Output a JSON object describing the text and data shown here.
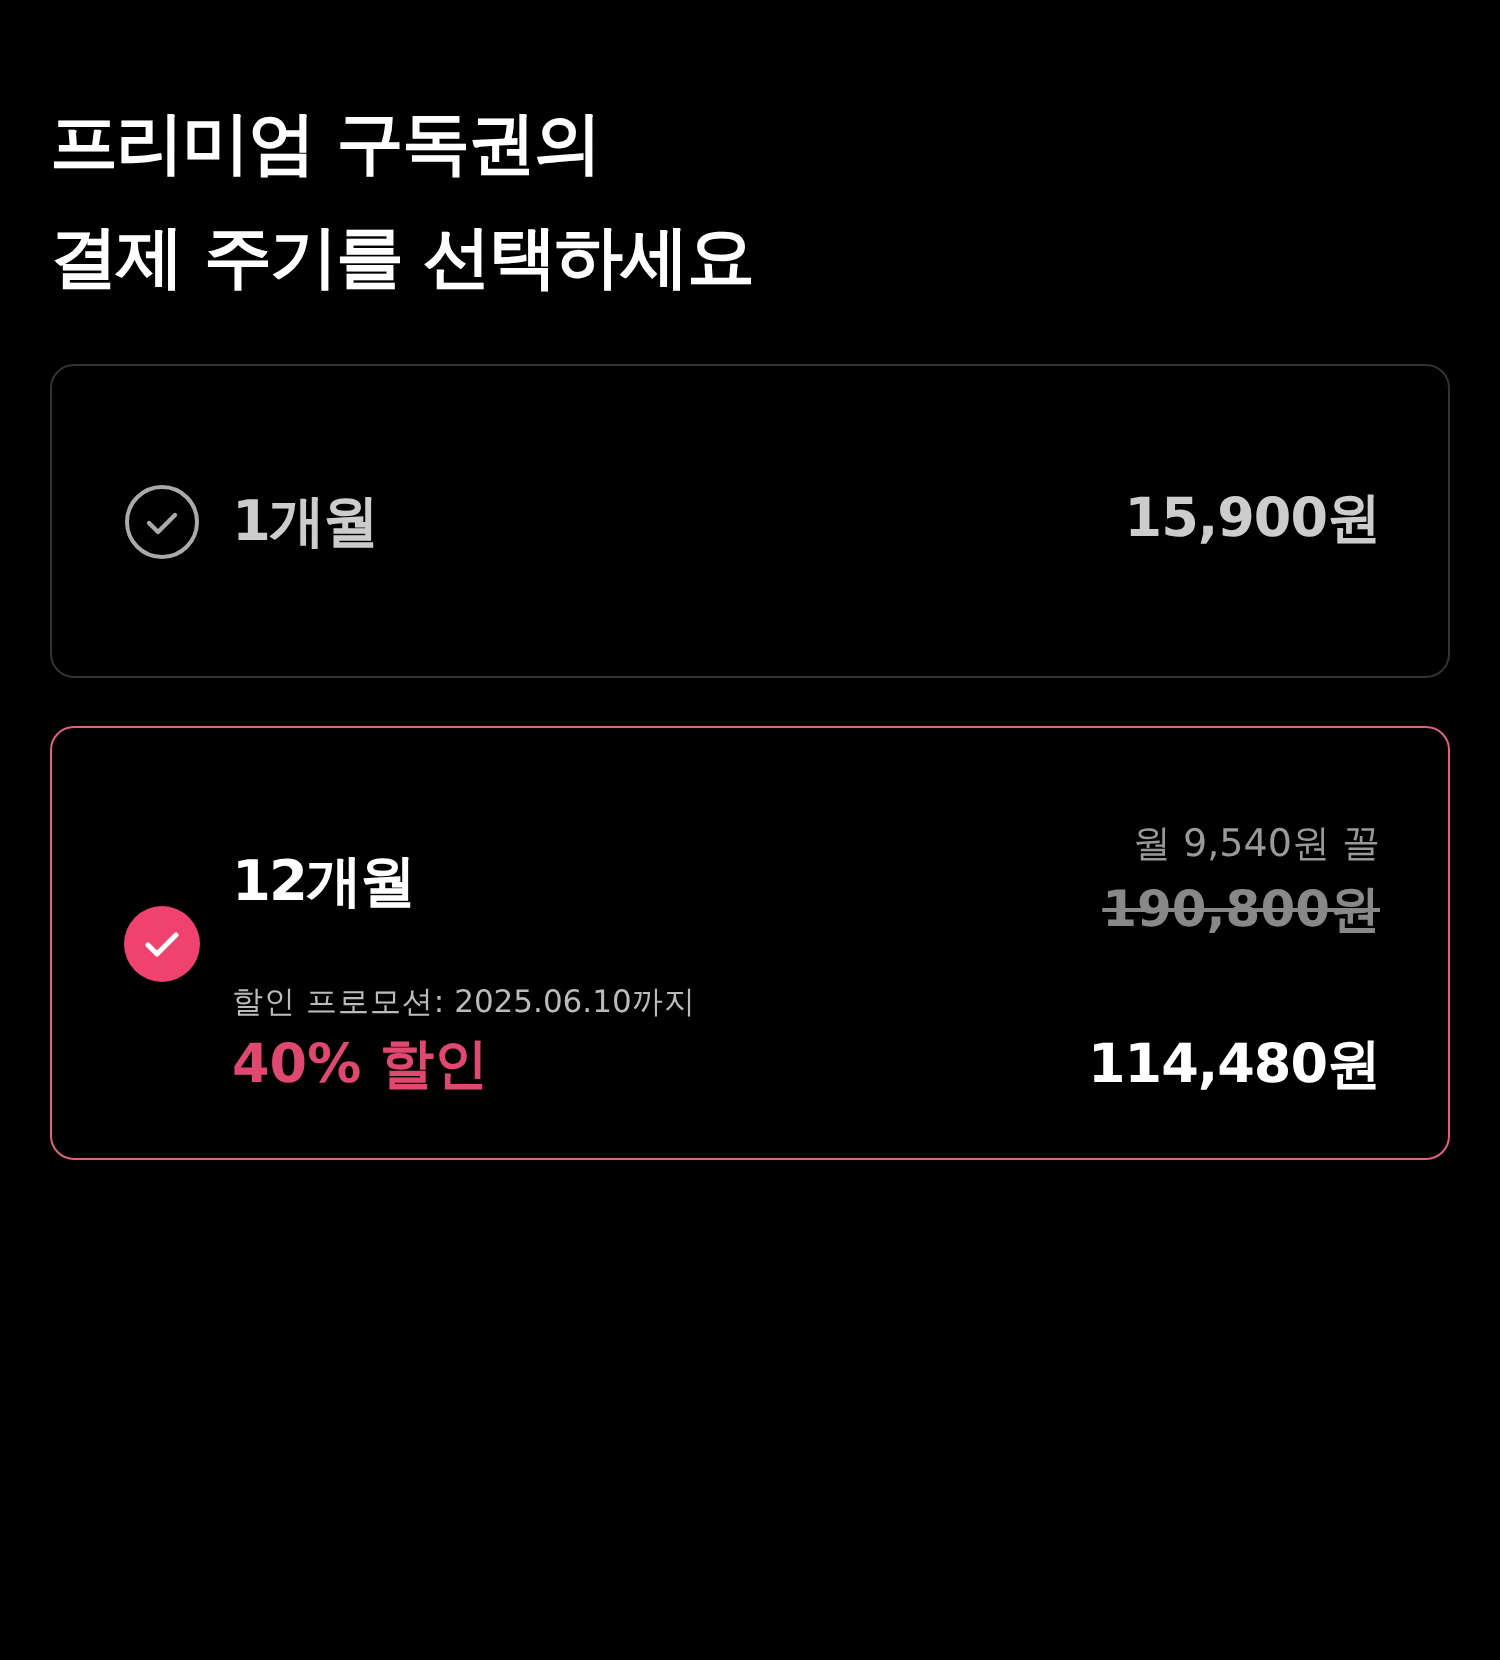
{
  "title_lines": [
    "프리미엄 구독권의",
    "결제 주기를 선택하세요"
  ],
  "plans": [
    {
      "period": "1개월",
      "price": "15,900원",
      "selected": false
    },
    {
      "period": "12개월",
      "monthly": "월 9,540원 꼴",
      "original_price": "190,800원",
      "promo": "할인 프로모션: 2025.06.10까지",
      "discount": "40% 할인",
      "price": "114,480원",
      "selected": true
    }
  ]
}
